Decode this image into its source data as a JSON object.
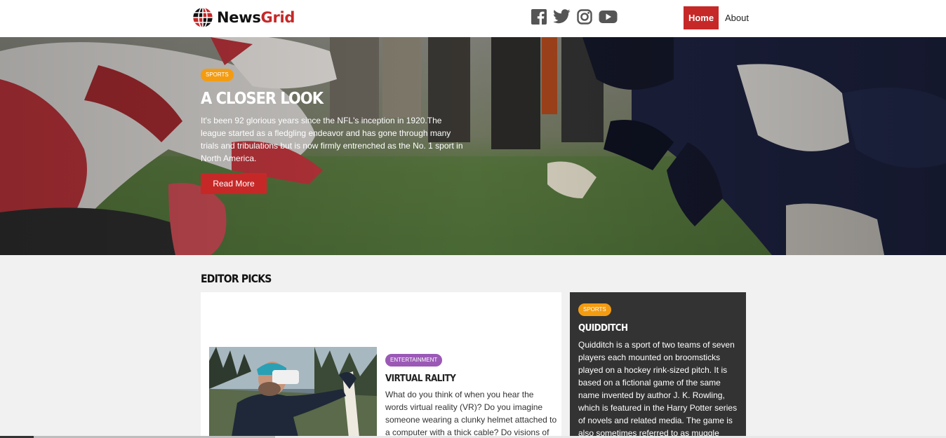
{
  "brand": {
    "name_part1": "News",
    "name_part2": "Grid"
  },
  "colors": {
    "accent": "#c62828",
    "sports": "#f39c12",
    "entertainment": "#9b59b6",
    "dark_card": "#333333"
  },
  "social": [
    {
      "icon": "facebook-icon"
    },
    {
      "icon": "twitter-icon"
    },
    {
      "icon": "instagram-icon"
    },
    {
      "icon": "youtube-icon"
    }
  ],
  "nav": {
    "home": "Home",
    "about": "About"
  },
  "hero": {
    "category": "SPORTS",
    "title": "A CLOSER LOOK",
    "text": "It's been 92 glorious years since the NFL's inception in 1920.The league started as a fledgling endeavor and has gone through many trials and tribulations but is now firmly entrenched as the No. 1 sport in North America.",
    "button": "Read More"
  },
  "editor_picks": {
    "title": "EDITOR PICKS",
    "main_card": {
      "category": "ENTERTAINMENT",
      "title": "VIRTUAL RALITY",
      "text": "What do you think of when you hear the words virtual reality (VR)? Do you imagine someone wearing a clunky helmet attached to a computer with a thick cable? Do visions of"
    },
    "side_card": {
      "category": "SPORTS",
      "title": "QUIDDITCH",
      "text": "Quidditch is a sport of two teams of seven players each mounted on broomsticks played on a hockey rink-sized pitch. It is based on a fictional game of the same name invented by author J. K. Rowling, which is featured in the Harry Potter series of novels and related media. The game is also sometimes referred to as muggle quidditch"
    }
  }
}
